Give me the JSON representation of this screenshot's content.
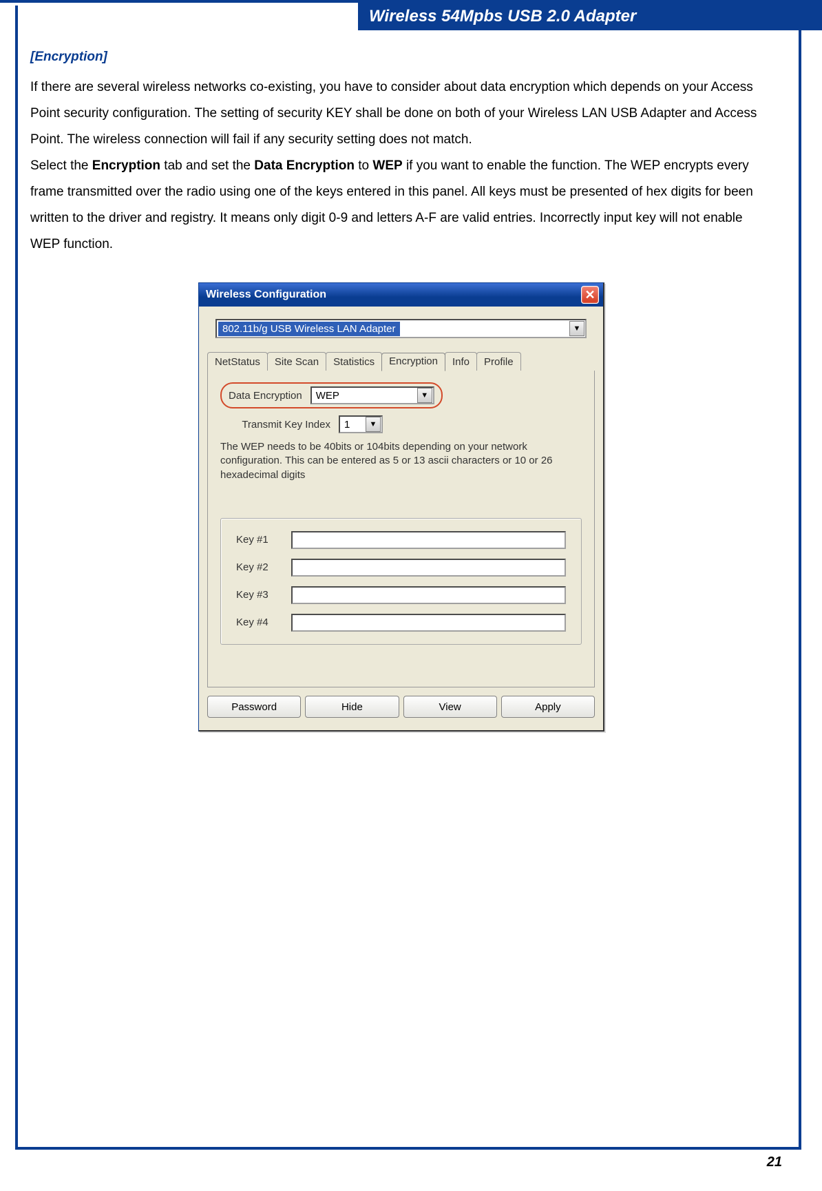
{
  "page": {
    "header_title": "Wireless 54Mpbs USB 2.0 Adapter",
    "page_number": "21"
  },
  "section": {
    "label": "[Encryption]",
    "para1_a": "If there are several wireless networks co-existing, you have to consider about data encryption which depends on your Access Point security configuration. The setting of security KEY shall be done on both of your Wireless LAN USB Adapter and Access Point. The wireless connection will fail if any security setting does not match.",
    "para2_pre": "Select the ",
    "para2_b1": "Encryption",
    "para2_mid1": " tab and set the ",
    "para2_b2": "Data Encryption",
    "para2_mid2": " to ",
    "para2_b3": "WEP",
    "para2_post": " if you want to enable the function. The WEP encrypts every frame transmitted over the radio using one of the keys entered in this panel. All keys must be presented of hex digits for been written to the driver and registry. It means only digit 0-9 and letters A-F are valid entries. Incorrectly input key will not enable WEP function."
  },
  "dialog": {
    "title": "Wireless Configuration",
    "adapter": "802.11b/g USB Wireless LAN Adapter",
    "tabs": [
      "NetStatus",
      "Site Scan",
      "Statistics",
      "Encryption",
      "Info",
      "Profile"
    ],
    "active_tab_index": 3,
    "data_encryption_label": "Data Encryption",
    "data_encryption_value": "WEP",
    "transmit_key_label": "Transmit Key Index",
    "transmit_key_value": "1",
    "help_text": "The WEP needs to be 40bits or 104bits depending on your network configuration. This can be entered as 5 or 13 ascii characters or 10 or 26 hexadecimal digits",
    "keys": [
      {
        "label": "Key #1",
        "value": ""
      },
      {
        "label": "Key #2",
        "value": ""
      },
      {
        "label": "Key #3",
        "value": ""
      },
      {
        "label": "Key #4",
        "value": ""
      }
    ],
    "buttons": [
      "Password",
      "Hide",
      "View",
      "Apply"
    ]
  }
}
